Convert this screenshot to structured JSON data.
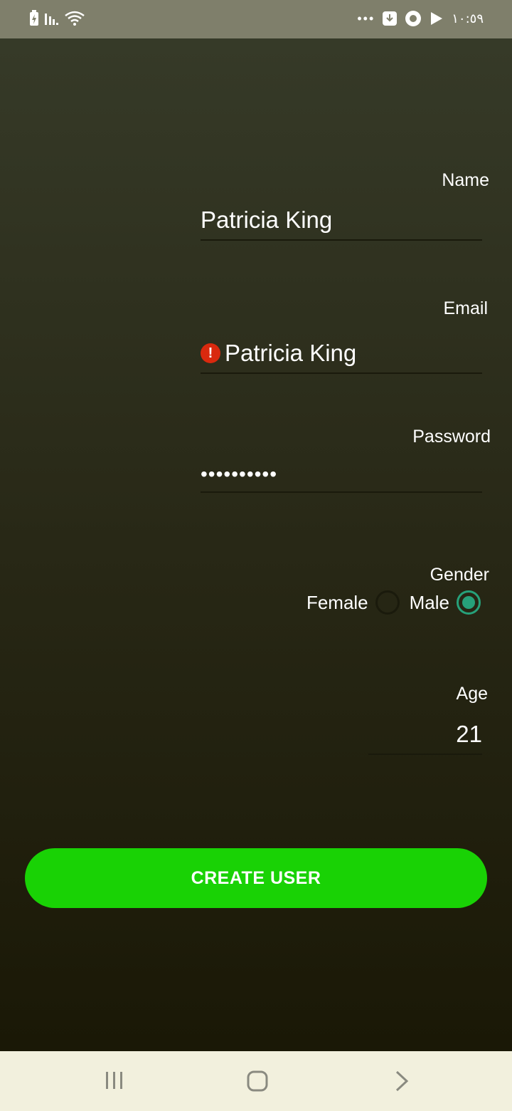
{
  "statusbar": {
    "time": "١٠:٥٩",
    "dots": "•••",
    "icons": [
      "battery-charging-icon",
      "signal-icon",
      "wifi-icon",
      "download-icon",
      "app-icon",
      "play-store-icon"
    ]
  },
  "form": {
    "name_label": "Name",
    "name_value": "Patricia King",
    "email_label": "Email",
    "email_value": "Patricia King",
    "email_error": "!",
    "password_label": "Password",
    "password_value": "••••••••••",
    "gender_label": "Gender",
    "gender_options": [
      "Female",
      "Male"
    ],
    "gender_selected": "Male",
    "age_label": "Age",
    "age_value": "21"
  },
  "actions": {
    "create_label": "CREATE USER"
  },
  "colors": {
    "accent": "#19d205",
    "radio_checked": "#26a17a",
    "error": "#d9290e"
  },
  "navbar": {
    "icons": [
      "recent-apps-icon",
      "home-icon",
      "back-icon"
    ]
  }
}
